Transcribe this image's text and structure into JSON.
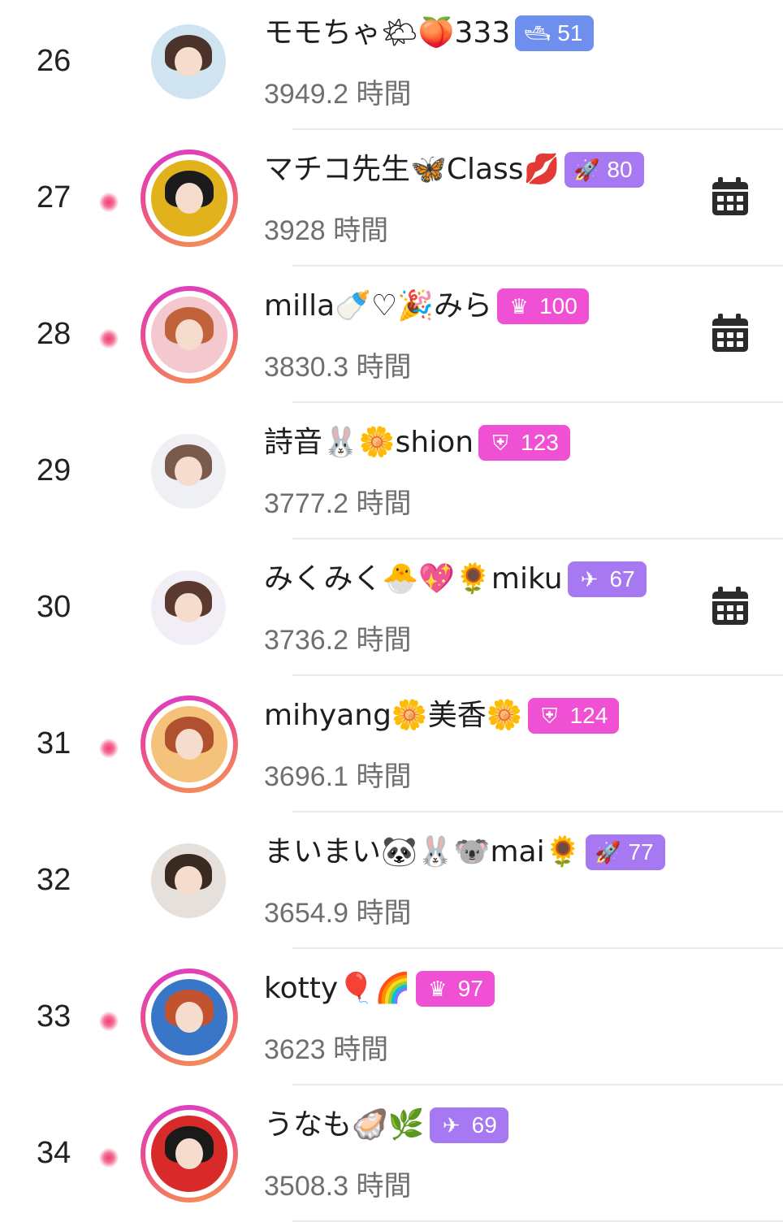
{
  "colors": {
    "rank_text": "#222222",
    "name_text": "#1e1e1e",
    "hours_text": "#6f6f6f",
    "live_ring_start": "#d93ad0",
    "live_ring_end": "#f59a4a",
    "live_dot": "#f23e74",
    "badge_blue": "#6f8fee",
    "badge_purple": "#a678f2",
    "badge_pink": "#f051d4",
    "calendar_icon": "#2b2b2b"
  },
  "ranking": [
    {
      "rank": "26",
      "name": "モモちゃ🌤🍑333",
      "badge": {
        "icon": "ship-icon",
        "glyph": "🛥",
        "value": "51",
        "color": "#6f8fee"
      },
      "hours": "3949.2 時間",
      "live": false,
      "schedule": false,
      "avatar": {
        "bg": "#cfe3f0",
        "hair": "#4a3328",
        "icon": "user-avatar"
      }
    },
    {
      "rank": "27",
      "name": "マチコ先生🦋Class💋",
      "badge": {
        "icon": "rocket-icon",
        "glyph": "🚀",
        "value": "80",
        "color": "#a678f2"
      },
      "hours": "3928 時間",
      "live": true,
      "schedule": true,
      "avatar": {
        "bg": "#e2b21c",
        "hair": "#1b1b1b",
        "icon": "user-avatar"
      }
    },
    {
      "rank": "28",
      "name": "milla🍼♡🎉みら",
      "badge": {
        "icon": "crown-icon",
        "glyph": "♛",
        "value": "100",
        "color": "#f051d4"
      },
      "hours": "3830.3 時間",
      "live": true,
      "schedule": true,
      "avatar": {
        "bg": "#f3c8cf",
        "hair": "#c0623a",
        "icon": "user-avatar"
      }
    },
    {
      "rank": "29",
      "name": "詩音🐰🌼shion",
      "badge": {
        "icon": "shield-icon",
        "glyph": "⛨",
        "value": "123",
        "color": "#f051d4"
      },
      "hours": "3777.2 時間",
      "live": false,
      "schedule": false,
      "avatar": {
        "bg": "#eef0f4",
        "hair": "#7a5a4a",
        "icon": "user-avatar"
      }
    },
    {
      "rank": "30",
      "name": "みくみく🐣💖🌻miku",
      "badge": {
        "icon": "plane-icon",
        "glyph": "✈",
        "value": "67",
        "color": "#a678f2"
      },
      "hours": "3736.2 時間",
      "live": false,
      "schedule": true,
      "avatar": {
        "bg": "#f2eef5",
        "hair": "#5a3a30",
        "icon": "user-avatar"
      }
    },
    {
      "rank": "31",
      "name": "mihyang🌼美香🌼",
      "badge": {
        "icon": "shield-icon",
        "glyph": "⛨",
        "value": "124",
        "color": "#f051d4"
      },
      "hours": "3696.1 時間",
      "live": true,
      "schedule": false,
      "avatar": {
        "bg": "#f4c27a",
        "hair": "#b0502e",
        "icon": "user-avatar"
      }
    },
    {
      "rank": "32",
      "name": "まいまい🐼🐰🐨mai🌻",
      "badge": {
        "icon": "rocket-icon",
        "glyph": "🚀",
        "value": "77",
        "color": "#a678f2"
      },
      "hours": "3654.9 時間",
      "live": false,
      "schedule": false,
      "avatar": {
        "bg": "#e6e0dc",
        "hair": "#3a2a22",
        "icon": "user-avatar"
      }
    },
    {
      "rank": "33",
      "name": "kotty🎈🌈",
      "badge": {
        "icon": "crown-icon",
        "glyph": "♛",
        "value": "97",
        "color": "#f051d4"
      },
      "hours": "3623 時間",
      "live": true,
      "schedule": false,
      "avatar": {
        "bg": "#3a76c8",
        "hair": "#c2532e",
        "icon": "user-avatar"
      }
    },
    {
      "rank": "34",
      "name": "うなも🦪🌿",
      "badge": {
        "icon": "plane-icon",
        "glyph": "✈",
        "value": "69",
        "color": "#a678f2"
      },
      "hours": "3508.3 時間",
      "live": true,
      "schedule": false,
      "avatar": {
        "bg": "#d92a2a",
        "hair": "#1a1a1a",
        "icon": "user-avatar"
      }
    }
  ]
}
